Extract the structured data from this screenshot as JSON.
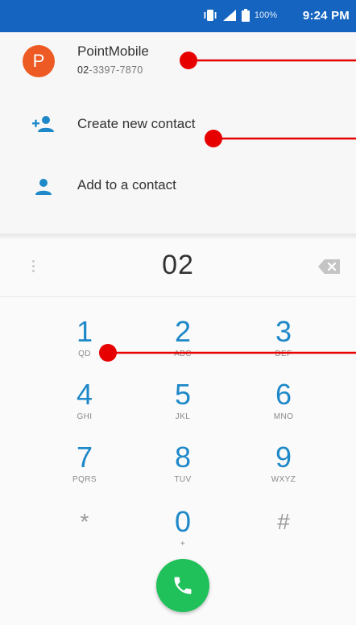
{
  "status_bar": {
    "battery_text": "100%",
    "time": "9:24 PM"
  },
  "suggestion": {
    "avatar_letter": "P",
    "name": "PointMobile",
    "number_prefix": "02",
    "number_rest": "-3397-7870"
  },
  "actions": [
    {
      "label": "Create new contact",
      "icon": "person-add-icon"
    },
    {
      "label": "Add to a contact",
      "icon": "person-icon"
    }
  ],
  "dial_field": {
    "digits": "02"
  },
  "keypad": {
    "keys": [
      {
        "digit": "1",
        "letters": "QD"
      },
      {
        "digit": "2",
        "letters": "ABC"
      },
      {
        "digit": "3",
        "letters": "DEF"
      },
      {
        "digit": "4",
        "letters": "GHI"
      },
      {
        "digit": "5",
        "letters": "JKL"
      },
      {
        "digit": "6",
        "letters": "MNO"
      },
      {
        "digit": "7",
        "letters": "PQRS"
      },
      {
        "digit": "8",
        "letters": "TUV"
      },
      {
        "digit": "9",
        "letters": "WXYZ"
      },
      {
        "digit": "*",
        "letters": ""
      },
      {
        "digit": "0",
        "letters": "+"
      },
      {
        "digit": "#",
        "letters": ""
      }
    ]
  },
  "colors": {
    "status_bar": "#1565c0",
    "accent": "#1e88c8",
    "call_button": "#20c05a",
    "avatar": "#ee5a24",
    "annotation": "#e60000"
  }
}
